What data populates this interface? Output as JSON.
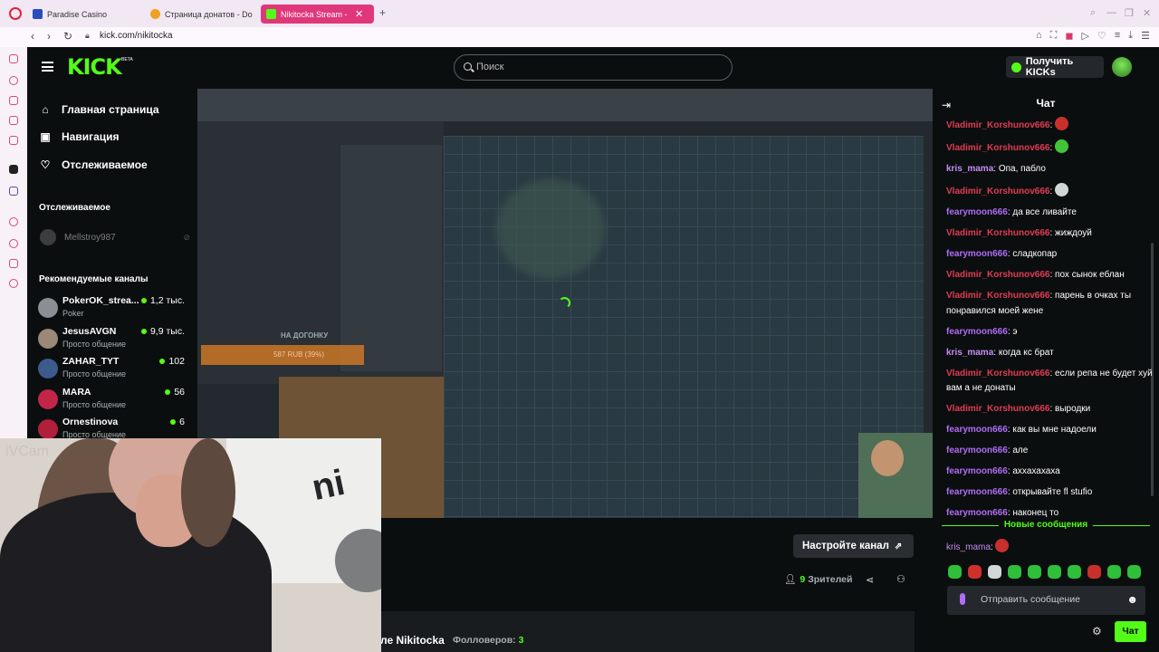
{
  "browser": {
    "tabs": [
      {
        "title": "Paradise Casino",
        "favicon_color": "#2a4dbd"
      },
      {
        "title": "Страница донатов - Don",
        "favicon_color": "#f0a020"
      },
      {
        "title": "Nikitocka Stream - Ki",
        "favicon_color": "#53fc18"
      }
    ],
    "url": "kick.com/nikitocka"
  },
  "header": {
    "logo": "KICK",
    "beta": "BETA",
    "search_placeholder": "Поиск",
    "kicks_button": "Получить KICKs"
  },
  "sidebar": {
    "nav": [
      {
        "label": "Главная страница",
        "icon": "home-icon"
      },
      {
        "label": "Навигация",
        "icon": "browse-icon"
      },
      {
        "label": "Отслеживаемое",
        "icon": "heart-icon"
      }
    ],
    "following_header": "Отслеживаемое",
    "following": [
      {
        "name": "Mellstroy987"
      }
    ],
    "recommended_header": "Рекомендуемые каналы",
    "recommended": [
      {
        "name": "PokerOK_strea...",
        "category": "Poker",
        "viewers": "1,2 тыс.",
        "color": "#8a8f94"
      },
      {
        "name": "JesusAVGN",
        "category": "Просто общение",
        "viewers": "9,9 тыс.",
        "color": "#9b8876"
      },
      {
        "name": "ZAHAR_TYT",
        "category": "Просто общение",
        "viewers": "102",
        "color": "#3a5b8c"
      },
      {
        "name": "MARA",
        "category": "Просто общение",
        "viewers": "56",
        "color": "#c2254a"
      },
      {
        "name": "Ornestinova",
        "category": "Просто общение",
        "viewers": "6",
        "color": "#b0203a"
      }
    ]
  },
  "stream": {
    "overlay_label": "НА ДОГОНКУ",
    "overlay_value": "587 RUB (39%)",
    "webcam_label": "iVCam",
    "setup_button": "Настройте канал",
    "viewers_count": "9",
    "viewers_label": "Зрителей",
    "about_title": "ле Nikitocka",
    "followers_label": "Фолловеров:",
    "followers_count": "3"
  },
  "chat": {
    "title": "Чат",
    "messages": [
      {
        "user": "Vladimir_Korshunov666",
        "text": "",
        "emote": "#c9302c",
        "ucls": "r"
      },
      {
        "user": "Vladimir_Korshunov666",
        "text": "",
        "emote": "#41c43a",
        "ucls": "r"
      },
      {
        "user": "kris_mama",
        "text": "Опа, пабло",
        "emote": "",
        "ucls": "v"
      },
      {
        "user": "Vladimir_Korshunov666",
        "text": "",
        "emote": "#cfd8d6",
        "ucls": "r"
      },
      {
        "user": "fearymoon666",
        "text": "да все ливайте",
        "emote": "",
        "ucls": "p"
      },
      {
        "user": "Vladimir_Korshunov666",
        "text": "жиждоуй",
        "emote": "",
        "ucls": "r"
      },
      {
        "user": "fearymoon666",
        "text": "сладкопар",
        "emote": "",
        "ucls": "p"
      },
      {
        "user": "Vladimir_Korshunov666",
        "text": "пох сынок еблан",
        "emote": "",
        "ucls": "r"
      },
      {
        "user": "Vladimir_Korshunov666",
        "text": "парень в очках ты понравился моей жене",
        "emote": "",
        "ucls": "r"
      },
      {
        "user": "fearymoon666",
        "text": "э",
        "emote": "",
        "ucls": "p"
      },
      {
        "user": "kris_mama",
        "text": "когда кс брат",
        "emote": "",
        "ucls": "v"
      },
      {
        "user": "Vladimir_Korshunov666",
        "text": "если репа не будет хуй вам а не донаты",
        "emote": "",
        "ucls": "r"
      },
      {
        "user": "Vladimir_Korshunov666",
        "text": "выродки",
        "emote": "",
        "ucls": "r"
      },
      {
        "user": "fearymoon666",
        "text": "как вы мне надоели",
        "emote": "",
        "ucls": "p"
      },
      {
        "user": "fearymoon666",
        "text": "але",
        "emote": "",
        "ucls": "p"
      },
      {
        "user": "fearymoon666",
        "text": "аххахахаха",
        "emote": "",
        "ucls": "p"
      },
      {
        "user": "fearymoon666",
        "text": "открывайте fl stufio",
        "emote": "",
        "ucls": "p"
      },
      {
        "user": "fearymoon666",
        "text": "наконец то",
        "emote": "",
        "ucls": "p"
      }
    ],
    "new_messages": "Новые сообщения",
    "last_message": {
      "user": "kris_mama",
      "emote": "#c9302c"
    },
    "emote_bar": [
      "#2fbf3a",
      "#d0302c",
      "#cfd8d6",
      "#2fbf3a",
      "#2fbf3a",
      "#2fbf3a",
      "#2fbf3a",
      "#c9302c",
      "#2fbf3a",
      "#2fbf3a"
    ],
    "input_placeholder": "Отправить сообщение",
    "send_button": "Чат"
  }
}
